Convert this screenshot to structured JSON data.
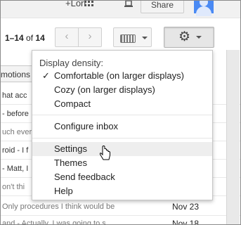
{
  "gbar": {
    "plus_text": "+Lori",
    "share_label": "Share"
  },
  "toolbar": {
    "range": "1–14",
    "of": "of",
    "total": "14",
    "prev_glyph": "‹",
    "next_glyph": "›"
  },
  "tabs": {
    "promotions_partial": "motions"
  },
  "emails": [
    {
      "subject": "hat acc",
      "snippet": "",
      "date": ""
    },
    {
      "subject": "- before",
      "snippet": "",
      "date": ""
    },
    {
      "subject": "",
      "snippet": "uch ever",
      "date": ""
    },
    {
      "subject": "roid - I f",
      "snippet": "",
      "date": ""
    },
    {
      "subject": "- Matt, I",
      "snippet": "",
      "date": ""
    },
    {
      "subject": "",
      "snippet": "on't thi",
      "date": ""
    },
    {
      "subject": "",
      "snippet": " Only procedures I think would be",
      "date": "Nov 23"
    },
    {
      "subject": "",
      "snippet": "and - Actually, I was going to s",
      "date": "Nov 18"
    }
  ],
  "menu": {
    "density_label": "Display density:",
    "density_options": [
      {
        "label": "Comfortable (on larger displays)",
        "checked": true
      },
      {
        "label": "Cozy (on larger displays)",
        "checked": false
      },
      {
        "label": "Compact",
        "checked": false
      }
    ],
    "check_glyph": "✓",
    "configure_inbox": "Configure inbox",
    "items": [
      {
        "label": "Settings",
        "hovered": true
      },
      {
        "label": "Themes",
        "hovered": false
      },
      {
        "label": "Send feedback",
        "hovered": false
      },
      {
        "label": "Help",
        "hovered": false
      }
    ]
  },
  "gear_glyph": "⚙",
  "colors": {
    "avatar_blue": "#4a8af4",
    "menu_hover": "#eeeeee"
  }
}
